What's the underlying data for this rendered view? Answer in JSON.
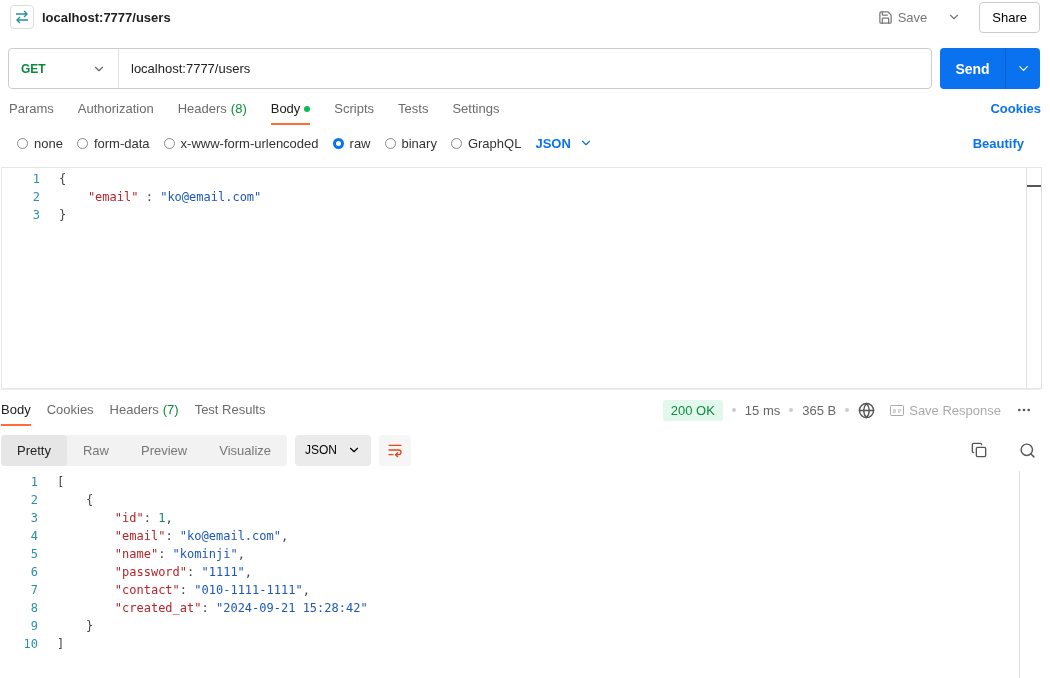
{
  "header": {
    "title": "localhost:7777/users",
    "save": "Save",
    "share": "Share"
  },
  "request": {
    "method": "GET",
    "url": "localhost:7777/users",
    "send": "Send"
  },
  "request_tabs": [
    {
      "label": "Params",
      "selected": false
    },
    {
      "label": "Authorization",
      "selected": false
    },
    {
      "label": "Headers",
      "count": "(8)",
      "selected": false
    },
    {
      "label": "Body",
      "dot": true,
      "selected": true
    },
    {
      "label": "Scripts",
      "selected": false
    },
    {
      "label": "Tests",
      "selected": false
    },
    {
      "label": "Settings",
      "selected": false
    }
  ],
  "cookies": "Cookies",
  "body_types": [
    {
      "label": "none",
      "selected": false
    },
    {
      "label": "form-data",
      "selected": false
    },
    {
      "label": "x-www-form-urlencoded",
      "selected": false
    },
    {
      "label": "raw",
      "selected": true
    },
    {
      "label": "binary",
      "selected": false
    },
    {
      "label": "GraphQL",
      "selected": false
    }
  ],
  "body_format": "JSON",
  "beautify": "Beautify",
  "request_body": [
    {
      "number": "1",
      "tokens": [
        {
          "kind": "punct",
          "text": "{"
        }
      ]
    },
    {
      "number": "2",
      "tokens": [
        {
          "kind": "key",
          "text": "    \"email\""
        },
        {
          "kind": "punct",
          "text": " : "
        },
        {
          "kind": "string",
          "text": "\"ko@email.com\""
        }
      ]
    },
    {
      "number": "3",
      "tokens": [
        {
          "kind": "punct",
          "text": "}"
        }
      ]
    }
  ],
  "response_tabs": [
    {
      "label": "Body",
      "selected": true
    },
    {
      "label": "Cookies",
      "selected": false
    },
    {
      "label": "Headers",
      "count": "(7)",
      "selected": false
    },
    {
      "label": "Test Results",
      "selected": false
    }
  ],
  "status": {
    "code": "200 OK",
    "time": "15 ms",
    "size": "365 B",
    "save_response": "Save Response"
  },
  "view_modes": [
    {
      "label": "Pretty",
      "selected": true
    },
    {
      "label": "Raw",
      "selected": false
    },
    {
      "label": "Preview",
      "selected": false
    },
    {
      "label": "Visualize",
      "selected": false
    }
  ],
  "response_format": "JSON",
  "response_body": [
    {
      "number": "1",
      "tokens": [
        {
          "kind": "punct",
          "text": "["
        }
      ]
    },
    {
      "number": "2",
      "tokens": [
        {
          "kind": "punct",
          "text": "    {"
        }
      ]
    },
    {
      "number": "3",
      "tokens": [
        {
          "kind": "key",
          "text": "        \"id\""
        },
        {
          "kind": "punct",
          "text": ": "
        },
        {
          "kind": "number",
          "text": "1"
        },
        {
          "kind": "punct",
          "text": ","
        }
      ]
    },
    {
      "number": "4",
      "tokens": [
        {
          "kind": "key",
          "text": "        \"email\""
        },
        {
          "kind": "punct",
          "text": ": "
        },
        {
          "kind": "string",
          "text": "\"ko@email.com\""
        },
        {
          "kind": "punct",
          "text": ","
        }
      ]
    },
    {
      "number": "5",
      "tokens": [
        {
          "kind": "key",
          "text": "        \"name\""
        },
        {
          "kind": "punct",
          "text": ": "
        },
        {
          "kind": "string",
          "text": "\"kominji\""
        },
        {
          "kind": "punct",
          "text": ","
        }
      ]
    },
    {
      "number": "6",
      "tokens": [
        {
          "kind": "key",
          "text": "        \"password\""
        },
        {
          "kind": "punct",
          "text": ": "
        },
        {
          "kind": "string",
          "text": "\"1111\""
        },
        {
          "kind": "punct",
          "text": ","
        }
      ]
    },
    {
      "number": "7",
      "tokens": [
        {
          "kind": "key",
          "text": "        \"contact\""
        },
        {
          "kind": "punct",
          "text": ": "
        },
        {
          "kind": "string",
          "text": "\"010-1111-1111\""
        },
        {
          "kind": "punct",
          "text": ","
        }
      ]
    },
    {
      "number": "8",
      "tokens": [
        {
          "kind": "key",
          "text": "        \"created_at\""
        },
        {
          "kind": "punct",
          "text": ": "
        },
        {
          "kind": "string",
          "text": "\"2024-09-21 15:28:42\""
        }
      ]
    },
    {
      "number": "9",
      "tokens": [
        {
          "kind": "punct",
          "text": "    }"
        }
      ]
    },
    {
      "number": "10",
      "tokens": [
        {
          "kind": "punct",
          "text": "]"
        }
      ]
    }
  ]
}
